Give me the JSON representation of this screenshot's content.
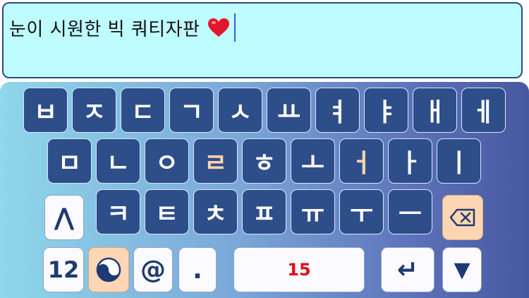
{
  "text_field": {
    "value": "눈이 시원한 빅 쿼티자판",
    "emoji": "heart"
  },
  "keyboard": {
    "row1": [
      "ㅂ",
      "ㅈ",
      "ㄷ",
      "ㄱ",
      "ㅅ",
      "ㅛ",
      "ㅕ",
      "ㅑ",
      "ㅐ",
      "ㅔ"
    ],
    "row2": [
      "ㅁ",
      "ㄴ",
      "ㅇ",
      "ㄹ",
      "ㅎ",
      "ㅗ",
      "ㅓ",
      "ㅏ",
      "ㅣ"
    ],
    "row3": [
      "ㅋ",
      "ㅌ",
      "ㅊ",
      "ㅍ",
      "ㅠ",
      "ㅜ",
      "ㅡ"
    ],
    "shift_label": "⋀",
    "backspace_icon": "backspace-icon",
    "numbers_label": "12",
    "lang_icon": "taegeuk-icon",
    "at_label": "@",
    "dot_label": ".",
    "space_label": "15",
    "return_label": "↵",
    "hide_label": "▼"
  },
  "colors": {
    "key_bg": "#2e4e8a",
    "highlight_text": "#ffd2ad",
    "textbox_bg": "#bffcff",
    "space_text": "#e0101a"
  }
}
